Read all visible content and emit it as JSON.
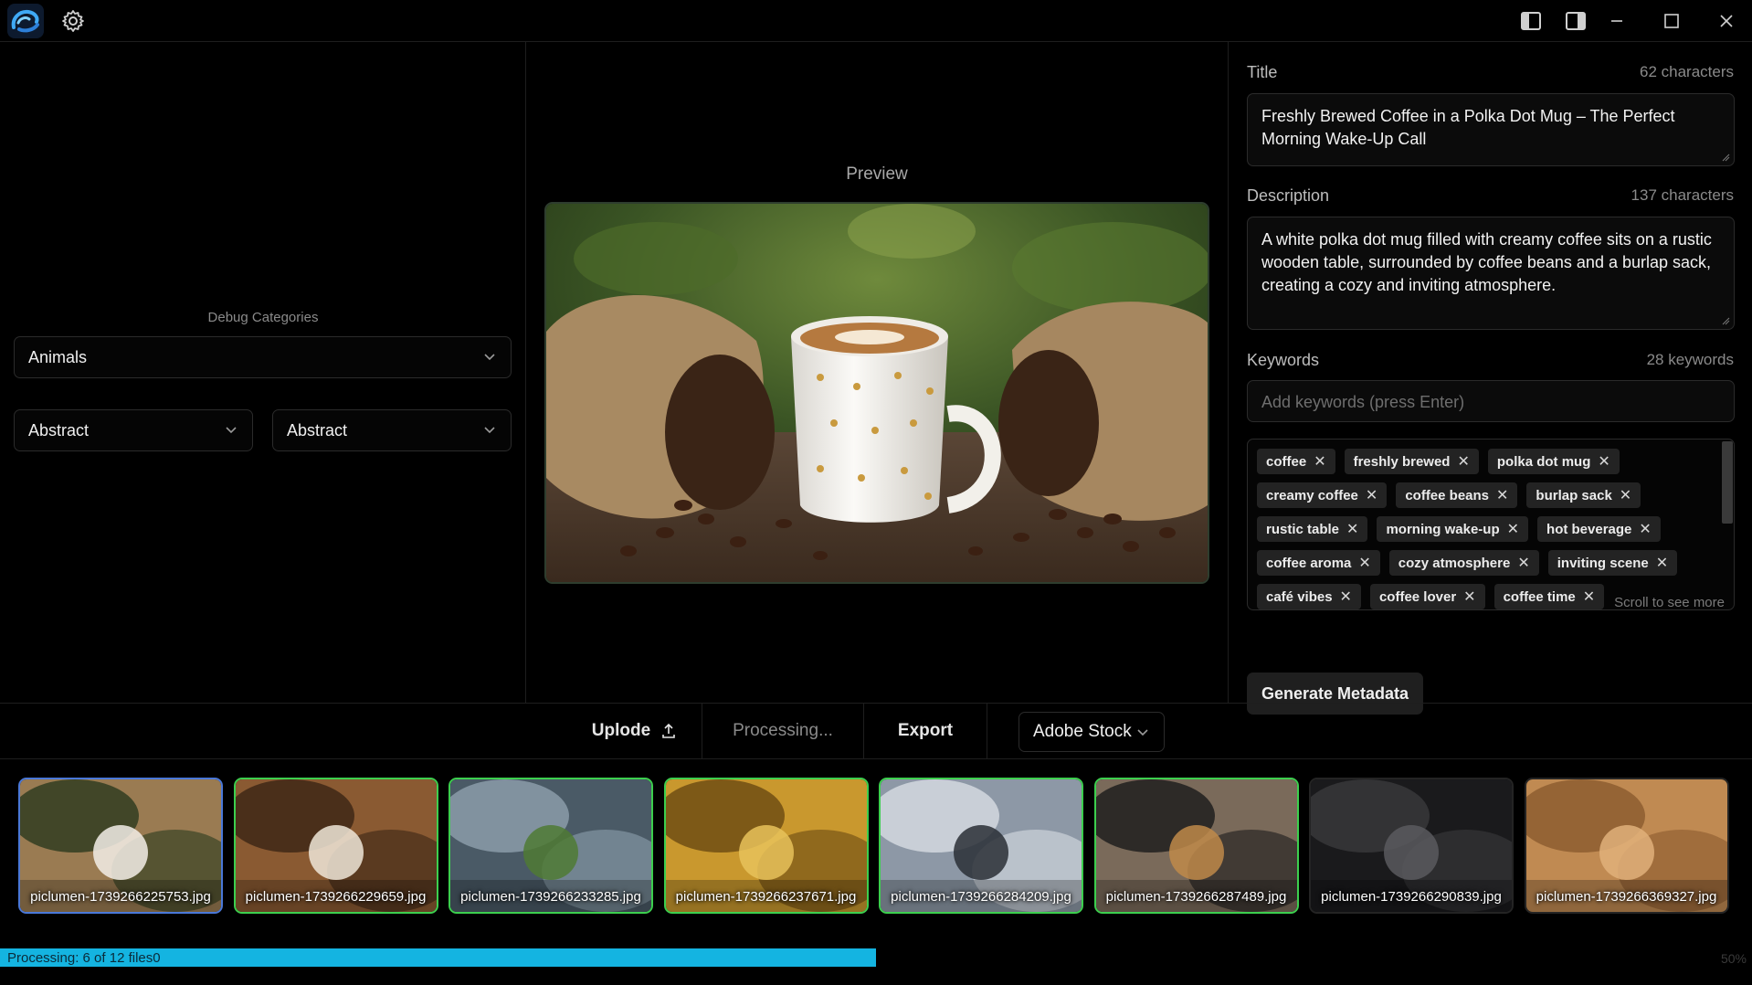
{
  "titlebar": {
    "icons": [
      "app-logo-icon",
      "gear-icon",
      "layout-left-panel-icon",
      "layout-right-panel-icon",
      "minimize-icon",
      "maximize-icon",
      "close-icon"
    ]
  },
  "left_panel": {
    "debug_label": "Debug Categories",
    "category_select": "Animals",
    "sub_select_1": "Abstract",
    "sub_select_2": "Abstract"
  },
  "preview": {
    "label": "Preview"
  },
  "metadata": {
    "title_label": "Title",
    "title_count": "62 characters",
    "title_value": "Freshly Brewed Coffee in a Polka Dot Mug – The Perfect Morning Wake-Up Call",
    "description_label": "Description",
    "description_count": "137 characters",
    "description_value": "A white polka dot mug filled with creamy coffee sits on a rustic wooden table, surrounded by coffee beans and a burlap sack, creating a cozy and inviting atmosphere.",
    "keywords_label": "Keywords",
    "keywords_count": "28 keywords",
    "keywords_placeholder": "Add keywords (press Enter)",
    "keywords": [
      [
        "coffee",
        "freshly brewed",
        "polka dot mug"
      ],
      [
        "creamy coffee",
        "coffee beans",
        "burlap sack"
      ],
      [
        "rustic table",
        "morning wake-up",
        "hot beverage"
      ],
      [
        "coffee aroma",
        "cozy atmosphere",
        "inviting scene"
      ],
      [
        "café vibes",
        "coffee lover",
        "coffee time"
      ]
    ],
    "remove_glyph": "✕",
    "scroll_hint": "Scroll to see more",
    "generate_button": "Generate Metadata"
  },
  "actions": {
    "upload": "Uplode",
    "processing": "Processing...",
    "export": "Export",
    "platform": "Adobe Stock"
  },
  "thumbnails": [
    {
      "file": "piclumen-1739266225753.jpg",
      "state": "selected"
    },
    {
      "file": "piclumen-1739266229659.jpg",
      "state": "done"
    },
    {
      "file": "piclumen-1739266233285.jpg",
      "state": "done"
    },
    {
      "file": "piclumen-1739266237671.jpg",
      "state": "done"
    },
    {
      "file": "piclumen-1739266284209.jpg",
      "state": "done"
    },
    {
      "file": "piclumen-1739266287489.jpg",
      "state": "done"
    },
    {
      "file": "piclumen-1739266290839.jpg",
      "state": "pending"
    },
    {
      "file": "piclumen-1739266369327.jpg",
      "state": "pending"
    }
  ],
  "progress": {
    "text": "Processing: 6 of 12 files0",
    "percent_label": "50%",
    "fraction": 0.5
  },
  "colors": {
    "accent": "#14b4e1",
    "done_border": "#3ccf4e",
    "selected_border": "#4a78d8"
  }
}
